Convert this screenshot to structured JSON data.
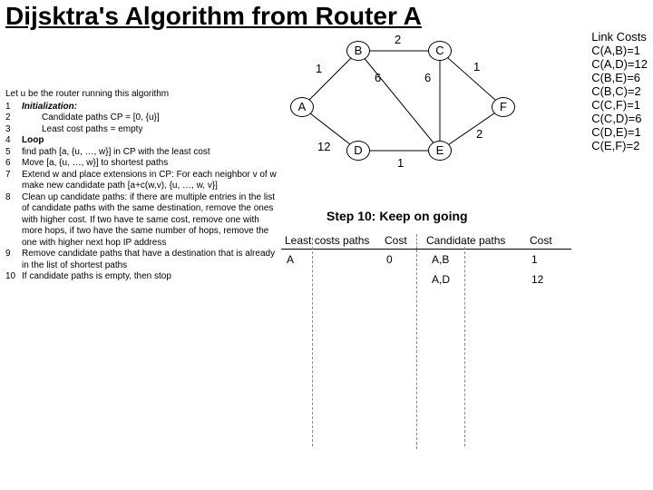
{
  "title": "Dijsktra's Algorithm from Router A",
  "algorithm": {
    "intro": "Let u be the router running this algorithm",
    "lines": [
      {
        "n": "1",
        "t": "Initialization:",
        "cls": "bold italic"
      },
      {
        "n": "2",
        "t": "Candidate paths CP = [0, {u}]",
        "indent": true
      },
      {
        "n": "3",
        "t": "Least cost paths = empty",
        "indent": true
      },
      {
        "n": "",
        "t": " "
      },
      {
        "n": "4",
        "t": "Loop",
        "cls": "bold"
      },
      {
        "n": "5",
        "t": "find path [a, {u, …, w}] in CP with the least cost"
      },
      {
        "n": "6",
        "t": "Move [a, {u, …, w}] to shortest paths"
      },
      {
        "n": "7",
        "t": "Extend w and place extensions in CP: For each neighbor v of w make new candidate path [a+c(w,v), {u, …, w, v}]"
      },
      {
        "n": "8",
        "t": "Clean up candidate paths: if there are multiple entries in the list of candidate paths with the same destination, remove the ones with higher cost. If two have te same cost, remove one with more hops, if two have the same number of hops, remove the one with higher next hop IP address"
      },
      {
        "n": "9",
        "t": "Remove candidate paths that have a destination that is already in the list of shortest paths"
      },
      {
        "n": "10",
        "t": "If candidate paths is empty, then stop"
      }
    ]
  },
  "graph": {
    "nodes": {
      "A": "A",
      "B": "B",
      "C": "C",
      "D": "D",
      "E": "E",
      "F": "F"
    },
    "edge_labels": {
      "AB": "1",
      "BC": "2",
      "CF": "1",
      "BE": "6",
      "CE": "6",
      "AD": "12",
      "DE": "1",
      "EF": "2"
    }
  },
  "link_costs": {
    "heading": "Link Costs",
    "rows": [
      "C(A,B)=1",
      "C(A,D)=12",
      "C(B,E)=6",
      "C(B,C)=2",
      "C(C,F)=1",
      "C(C,D)=6",
      "C(D,E)=1",
      "C(E,F)=2"
    ]
  },
  "step_caption": "Step 10: Keep on going",
  "tables": {
    "headers": {
      "lp": "Least costs paths",
      "lc": "Cost",
      "cp": "Candidate paths",
      "cc": "Cost"
    },
    "least": [
      {
        "path": "A",
        "cost": "0"
      }
    ],
    "cand": [
      {
        "path": "A,B",
        "cost": "1"
      },
      {
        "path": "A,D",
        "cost": "12"
      }
    ]
  },
  "chart_data": {
    "type": "table",
    "title": "Dijkstra's Algorithm from Router A — Step 10",
    "graph": {
      "nodes": [
        "A",
        "B",
        "C",
        "D",
        "E",
        "F"
      ],
      "edges": [
        {
          "u": "A",
          "v": "B",
          "w": 1
        },
        {
          "u": "A",
          "v": "D",
          "w": 12
        },
        {
          "u": "B",
          "v": "C",
          "w": 2
        },
        {
          "u": "B",
          "v": "E",
          "w": 6
        },
        {
          "u": "C",
          "v": "E",
          "w": 6
        },
        {
          "u": "C",
          "v": "F",
          "w": 1
        },
        {
          "u": "D",
          "v": "E",
          "w": 1
        },
        {
          "u": "E",
          "v": "F",
          "w": 2
        }
      ]
    },
    "link_costs": {
      "C(A,B)": 1,
      "C(A,D)": 12,
      "C(B,E)": 6,
      "C(B,C)": 2,
      "C(C,F)": 1,
      "C(C,D)": 6,
      "C(D,E)": 1,
      "C(E,F)": 2
    },
    "least_cost_paths": [
      {
        "path": [
          "A"
        ],
        "cost": 0
      }
    ],
    "candidate_paths": [
      {
        "path": [
          "A",
          "B"
        ],
        "cost": 1
      },
      {
        "path": [
          "A",
          "D"
        ],
        "cost": 12
      }
    ]
  }
}
